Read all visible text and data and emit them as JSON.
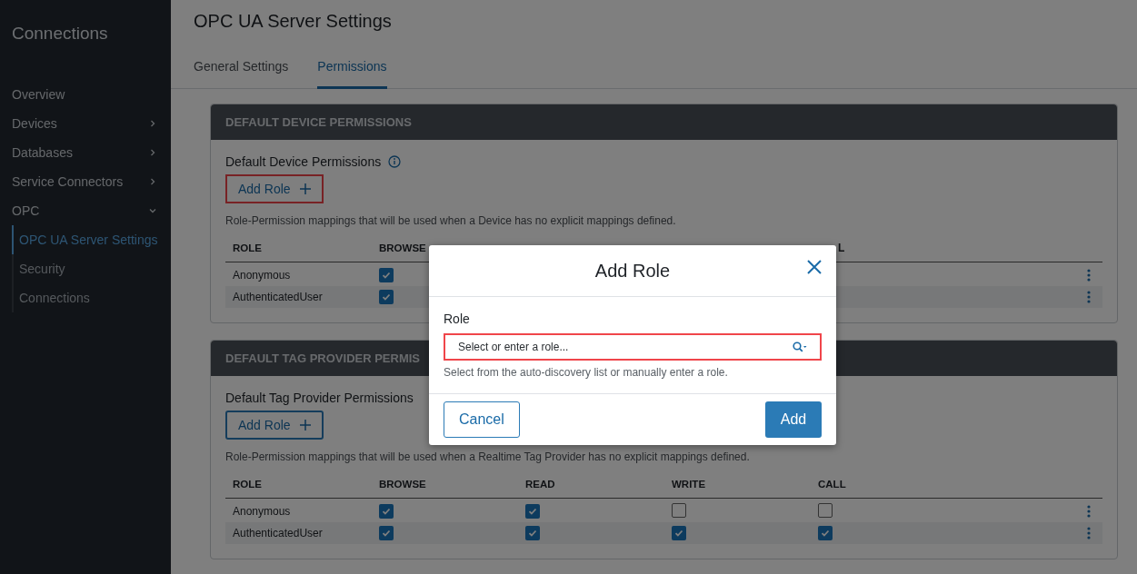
{
  "sidebar": {
    "title": "Connections",
    "items": [
      {
        "kind": "link",
        "label": "Overview",
        "selected": false
      },
      {
        "kind": "group",
        "label": "Devices",
        "expanded": false
      },
      {
        "kind": "group",
        "label": "Databases",
        "expanded": false
      },
      {
        "kind": "group",
        "label": "Service Connectors",
        "expanded": false
      },
      {
        "kind": "group",
        "label": "OPC",
        "expanded": true,
        "children": [
          {
            "label": "OPC UA Server Settings",
            "selected": true
          },
          {
            "label": "Security",
            "selected": false
          },
          {
            "label": "Connections",
            "selected": false
          }
        ]
      }
    ]
  },
  "page": {
    "title": "OPC UA Server Settings",
    "tabs": [
      {
        "label": "General Settings",
        "selected": false
      },
      {
        "label": "Permissions",
        "selected": true
      }
    ]
  },
  "cards": [
    {
      "header": "DEFAULT DEVICE PERMISSIONS",
      "title": "Default Device Permissions",
      "info": true,
      "add_button": {
        "label": "Add Role",
        "highlighted": true
      },
      "description": "Role-Permission mappings that will be used when a Device has no explicit mappings defined.",
      "columns": [
        "ROLE",
        "BROWSE"
      ],
      "column_5": "L",
      "rows": [
        {
          "role": "Anonymous",
          "permissions": [
            {
              "checked": true
            }
          ]
        },
        {
          "role": "AuthenticatedUser",
          "permissions": [
            {
              "checked": true
            }
          ]
        }
      ]
    },
    {
      "header": "DEFAULT TAG PROVIDER PERMIS",
      "title": "Default Tag Provider Permissions",
      "info": false,
      "add_button": {
        "label": "Add Role",
        "highlighted": false
      },
      "description": "Role-Permission mappings that will be used when a Realtime Tag Provider has no explicit mappings defined.",
      "columns": [
        "ROLE",
        "BROWSE",
        "READ",
        "WRITE",
        "CALL"
      ],
      "rows": [
        {
          "role": "Anonymous",
          "permissions": [
            {
              "checked": true
            },
            {
              "checked": true
            },
            {
              "checked": false
            },
            {
              "checked": false
            }
          ]
        },
        {
          "role": "AuthenticatedUser",
          "permissions": [
            {
              "checked": true
            },
            {
              "checked": true
            },
            {
              "checked": true
            },
            {
              "checked": true
            }
          ]
        }
      ]
    }
  ],
  "modal": {
    "title": "Add Role",
    "field_label": "Role",
    "field": {
      "placeholder": "Select or enter a role...",
      "highlighted": true
    },
    "hint": "Select from the auto-discovery list or manually enter a role.",
    "buttons": [
      {
        "kind": "secondary",
        "label": "Cancel"
      },
      {
        "kind": "primary",
        "label": "Add"
      }
    ]
  }
}
